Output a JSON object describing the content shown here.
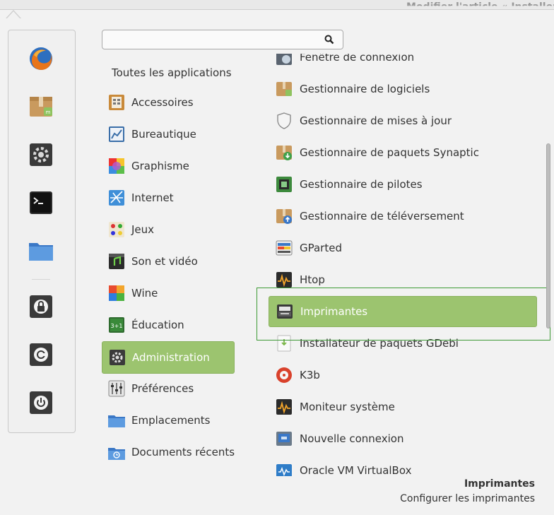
{
  "window": {
    "background_title": "Modifier l'article « Installer"
  },
  "search": {
    "placeholder": ""
  },
  "favorites": [
    {
      "name": "Firefox",
      "icon": "firefox-icon"
    },
    {
      "name": "Gestionnaire de logiciels",
      "icon": "software-manager-icon"
    },
    {
      "name": "Paramètres système",
      "icon": "system-settings-icon"
    },
    {
      "name": "Terminal",
      "icon": "terminal-icon"
    },
    {
      "name": "Dossier personnel",
      "icon": "folder-icon"
    },
    {
      "name": "Verrouiller l'écran",
      "icon": "lock-icon"
    },
    {
      "name": "Fermer la session",
      "icon": "logout-icon"
    },
    {
      "name": "Éteindre",
      "icon": "power-icon"
    }
  ],
  "categories": {
    "all": "Toutes les applications",
    "items": [
      {
        "label": "Accessoires",
        "icon": "accessories-icon"
      },
      {
        "label": "Bureautique",
        "icon": "office-icon"
      },
      {
        "label": "Graphisme",
        "icon": "graphics-icon"
      },
      {
        "label": "Internet",
        "icon": "internet-icon"
      },
      {
        "label": "Jeux",
        "icon": "games-icon"
      },
      {
        "label": "Son et vidéo",
        "icon": "multimedia-icon"
      },
      {
        "label": "Wine",
        "icon": "wine-icon"
      },
      {
        "label": "Éducation",
        "icon": "education-icon"
      },
      {
        "label": "Administration",
        "icon": "administration-icon",
        "selected": true
      },
      {
        "label": "Préférences",
        "icon": "preferences-icon"
      },
      {
        "label": "Emplacements",
        "icon": "places-icon"
      },
      {
        "label": "Documents récents",
        "icon": "recent-documents-icon"
      }
    ]
  },
  "apps": {
    "items": [
      {
        "label": "Fenêtre de connexion",
        "icon": "login-window-icon"
      },
      {
        "label": "Gestionnaire de logiciels",
        "icon": "software-manager-icon"
      },
      {
        "label": "Gestionnaire de mises à jour",
        "icon": "shield-icon"
      },
      {
        "label": "Gestionnaire de paquets Synaptic",
        "icon": "synaptic-icon"
      },
      {
        "label": "Gestionnaire de pilotes",
        "icon": "driver-manager-icon"
      },
      {
        "label": "Gestionnaire de téléversement",
        "icon": "upload-manager-icon"
      },
      {
        "label": "GParted",
        "icon": "gparted-icon"
      },
      {
        "label": "Htop",
        "icon": "htop-icon"
      },
      {
        "label": "Imprimantes",
        "icon": "printer-icon",
        "selected": true
      },
      {
        "label": "Installateur de paquets GDebi",
        "icon": "gdebi-icon"
      },
      {
        "label": "K3b",
        "icon": "k3b-icon"
      },
      {
        "label": "Moniteur système",
        "icon": "system-monitor-icon"
      },
      {
        "label": "Nouvelle connexion",
        "icon": "new-connection-icon"
      },
      {
        "label": "Oracle VM VirtualBox",
        "icon": "virtualbox-icon"
      }
    ]
  },
  "description": {
    "title": "Imprimantes",
    "text": "Configurer les imprimantes"
  },
  "colors": {
    "selection": "#9cc46f",
    "focus_outline": "#3e9a36"
  }
}
